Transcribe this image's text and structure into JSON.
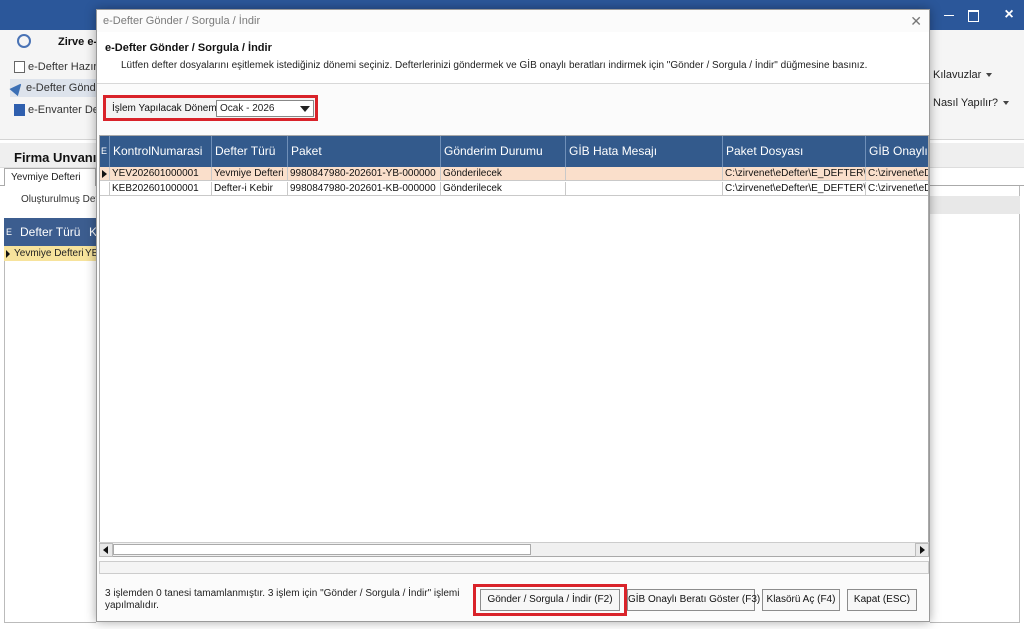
{
  "background": {
    "ribbon": {
      "tab": "Zirve e-",
      "items": [
        "e-Defter Hazırla",
        "e-Defter Gönde",
        "e-Envanter Deft"
      ],
      "right_menu": [
        "Kılavuzlar",
        "Nasıl Yapılır?"
      ]
    },
    "firma_label": "Firma Unvanı :",
    "tab": "Yevmiye Defteri",
    "sub_label": "Oluşturulmuş Deft",
    "grid": {
      "header_marker": "E",
      "header_col1": "Defter Türü",
      "header_col2": "K",
      "row_col1": "Yevmiye Defteri",
      "row_col2": "YE"
    }
  },
  "dialog": {
    "title": "e-Defter Gönder / Sorgula / İndir",
    "heading": "e-Defter Gönder / Sorgula / İndir",
    "description": "Lütfen defter dosyalarını eşitlemek istediğiniz dönemi seçiniz. Defterlerinizi göndermek ve GİB onaylı beratları indirmek için \"Gönder / Sorgula / İndir\" düğmesine basınız.",
    "period": {
      "label": "İşlem Yapılacak Dönem",
      "value": "Ocak - 2026"
    },
    "grid": {
      "marker": "E",
      "columns": [
        "KontrolNumarasi",
        "Defter Türü",
        "Paket",
        "Gönderim Durumu",
        "GİB Hata Mesajı",
        "Paket Dosyası",
        "GİB Onaylı P"
      ],
      "rows": [
        [
          "YEV202601000001",
          "Yevmiye Defteri",
          "9980847980-202601-YB-000000",
          "Gönderilecek",
          "",
          "C:\\zirvenet\\eDefter\\E_DEFTER\\99",
          "C:\\zirvenet\\eDe"
        ],
        [
          "KEB202601000001",
          "Defter-i Kebir",
          "9980847980-202601-KB-000000",
          "Gönderilecek",
          "",
          "C:\\zirvenet\\eDefter\\E_DEFTER\\99",
          "C:\\zirvenet\\eDe"
        ]
      ]
    },
    "status_text": "3 işlemden 0 tanesi tamamlanmıştır. 3 işlem için \"Gönder / Sorgula / İndir\" işlemi yapılmalıdır.",
    "buttons": {
      "send": "Gönder / Sorgula / İndir (F2)",
      "gib": "GİB Onaylı Beratı Göster (F3)",
      "folder": "Klasörü Aç (F4)",
      "close": "Kapat (ESC)"
    }
  },
  "colors": {
    "grid_header": "#335a8c",
    "selected_row": "#fadfcb",
    "highlight": "#d9232a",
    "app_titlebar": "#2b579a"
  }
}
